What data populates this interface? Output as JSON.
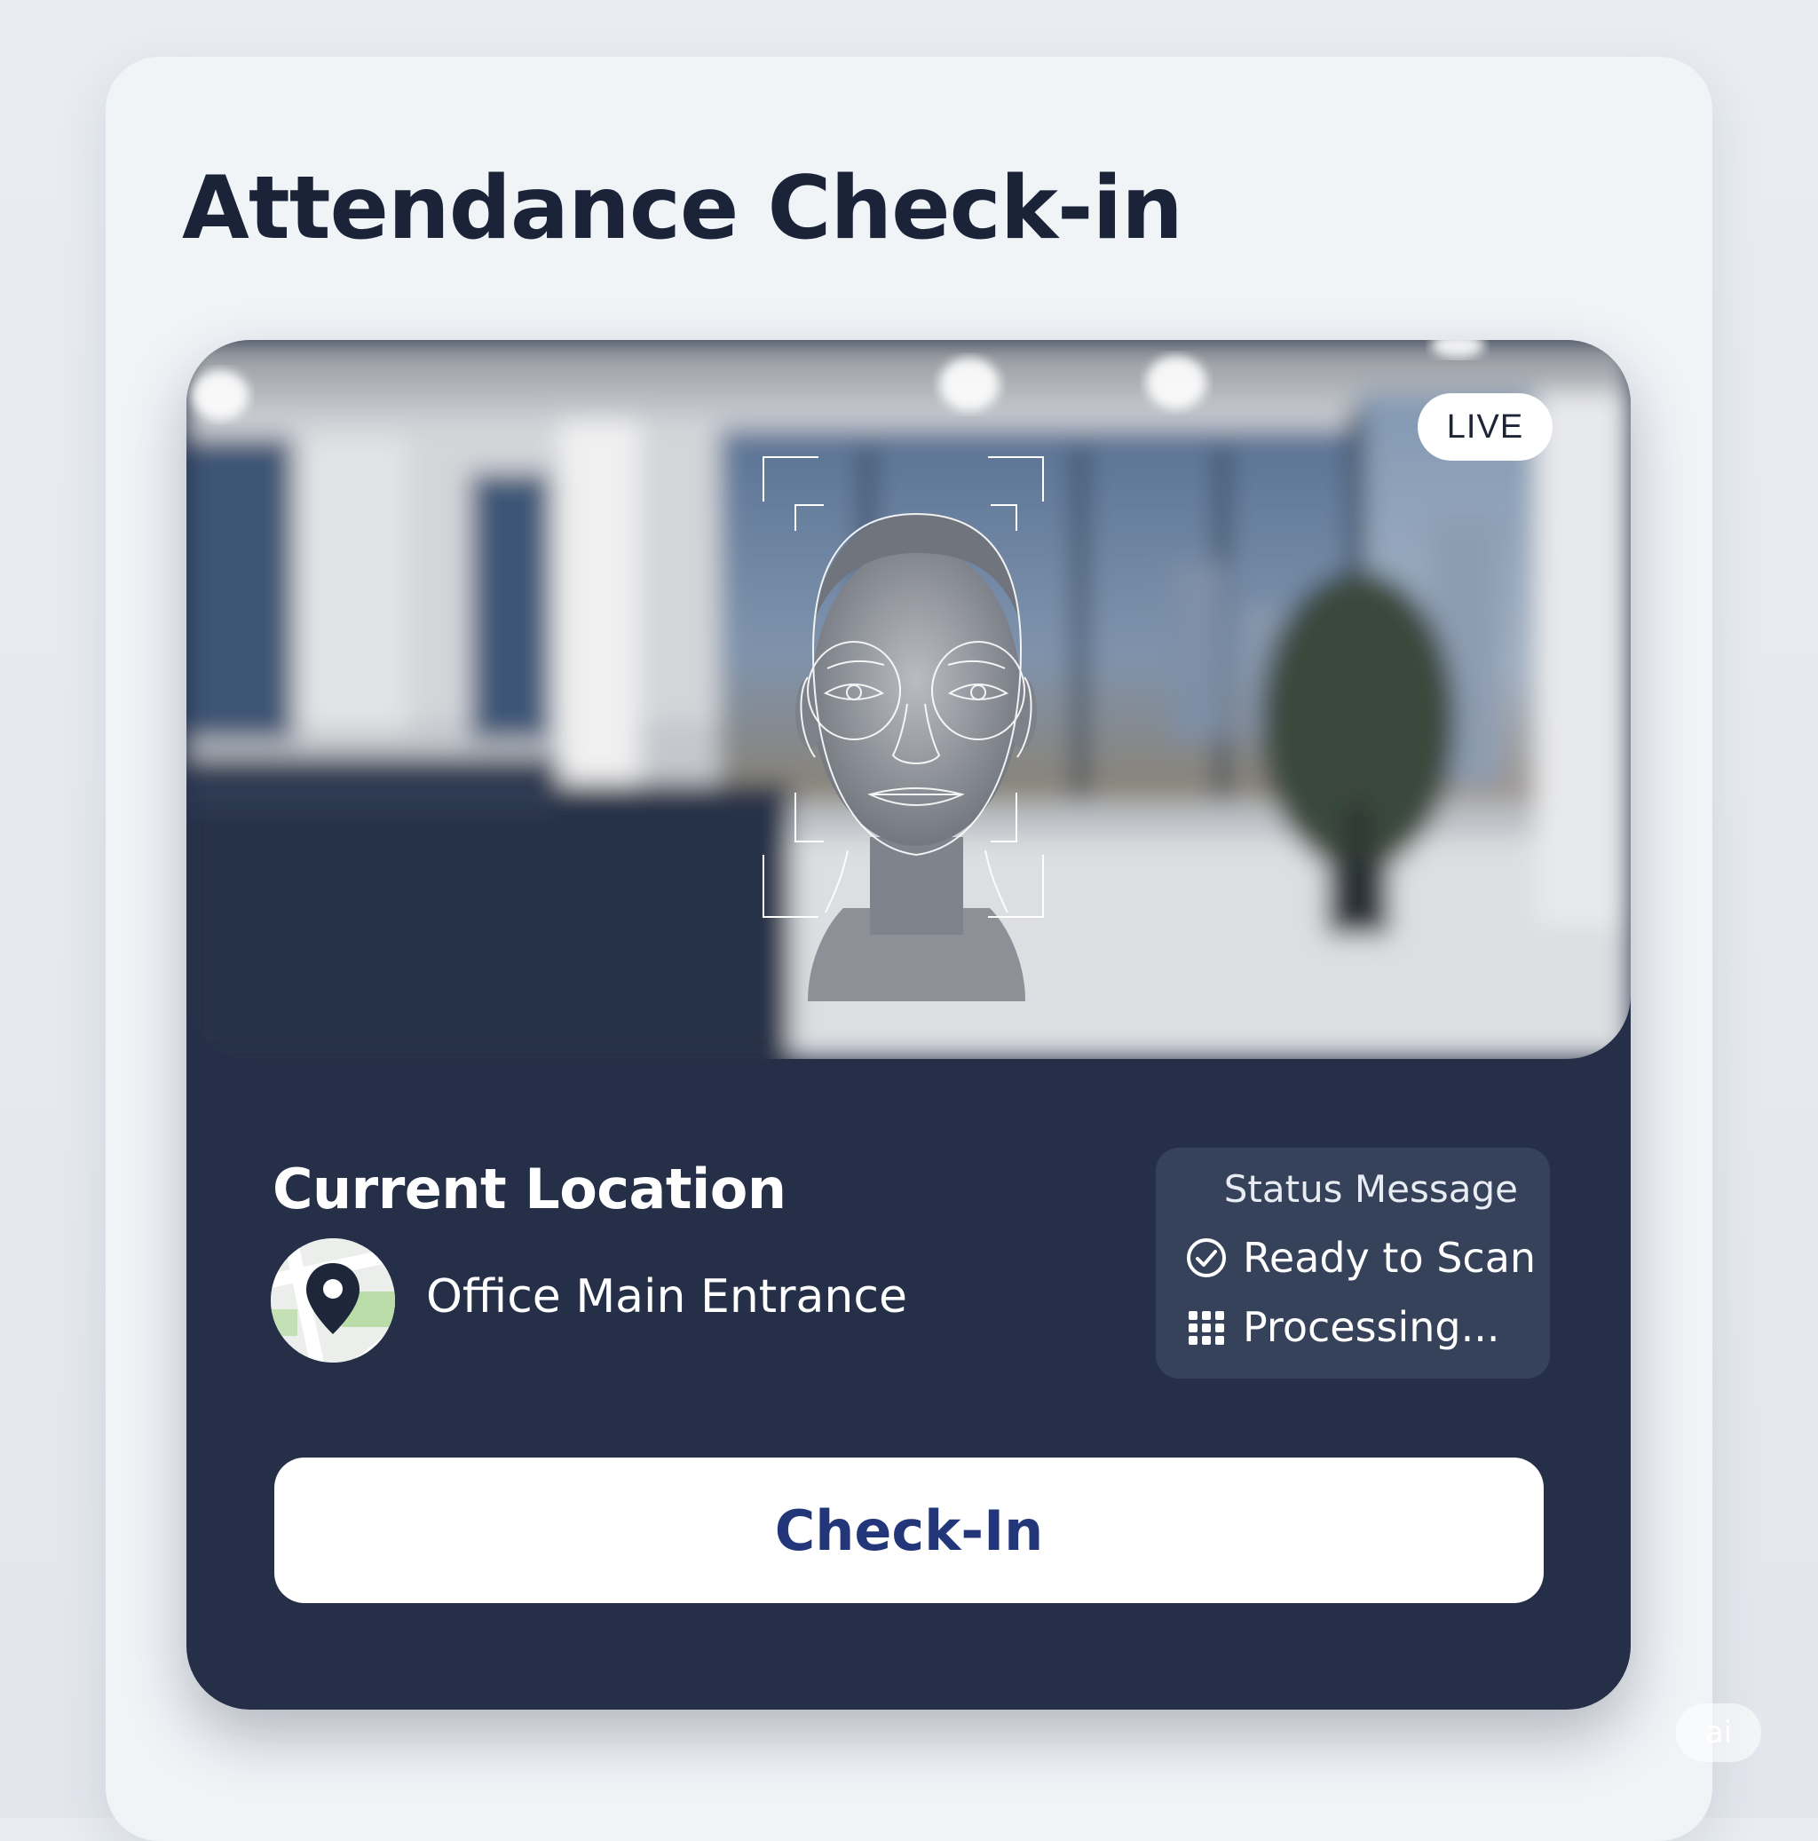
{
  "app": {
    "title": "Attendance Check-in"
  },
  "camera": {
    "live_badge": "LIVE",
    "face_frame_icon": "face-scan-frame"
  },
  "location": {
    "heading": "Current Location",
    "value": "Office Main Entrance",
    "icon": "map-pin-icon"
  },
  "status": {
    "title": "Status Message",
    "items": [
      {
        "label": "Ready to Scan",
        "icon": "check-circle-icon"
      },
      {
        "label": "Processing...",
        "icon": "grid-dots-icon"
      }
    ]
  },
  "actions": {
    "checkin_label": "Check-In"
  },
  "watermark": {
    "text": "ai"
  },
  "colors": {
    "page_background": "#e6eaef",
    "card_background": "#f1f4f7",
    "panel_navy": "#252f47",
    "status_panel": "#36415a",
    "button_text": "#24367a",
    "title_text": "#1b2338"
  }
}
